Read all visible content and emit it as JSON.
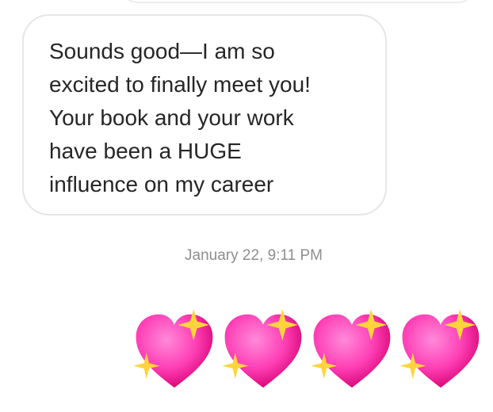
{
  "conversation": {
    "message": {
      "text": "Sounds good—I am so\nexcited to finally meet you!\nYour book and your work\nhave been a HUGE\ninfluence on my career"
    },
    "timestamp": "January 22, 9:11 PM",
    "reply": {
      "emoji_icon": "sparkling-heart-icon",
      "count": 4,
      "colors": {
        "heart_light": "#ff6fd0",
        "heart_dark": "#d3006f",
        "sparkle": "#ffd43b"
      }
    }
  }
}
